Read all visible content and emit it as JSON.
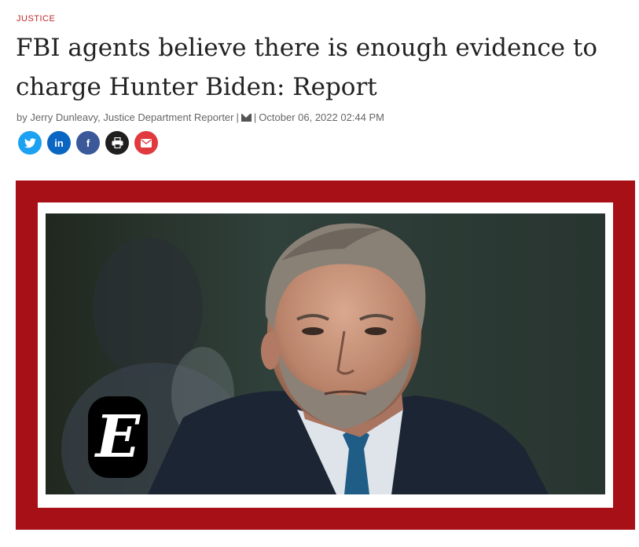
{
  "article": {
    "section": "JUSTICE",
    "headline": "FBI agents believe there is enough evidence to charge Hunter Biden: Report",
    "byline_prefix": "by",
    "author": "Jerry Dunleavy, Justice Department Reporter",
    "separator": "|",
    "date": "October 06, 2022 02:44 PM"
  },
  "share_buttons": [
    {
      "icon": "twitter-icon",
      "glyph": "",
      "color": "#1da1f2"
    },
    {
      "icon": "linkedin-icon",
      "glyph": "in",
      "color": "#0a66c2"
    },
    {
      "icon": "facebook-icon",
      "glyph": "f",
      "color": "#3b5998"
    },
    {
      "icon": "print-icon",
      "glyph": "",
      "color": "#1f1f1f"
    },
    {
      "icon": "email-icon",
      "glyph": "",
      "color": "#e0393e"
    }
  ],
  "hero_image": {
    "frame_color": "#a81018",
    "logo_letter": "E"
  }
}
